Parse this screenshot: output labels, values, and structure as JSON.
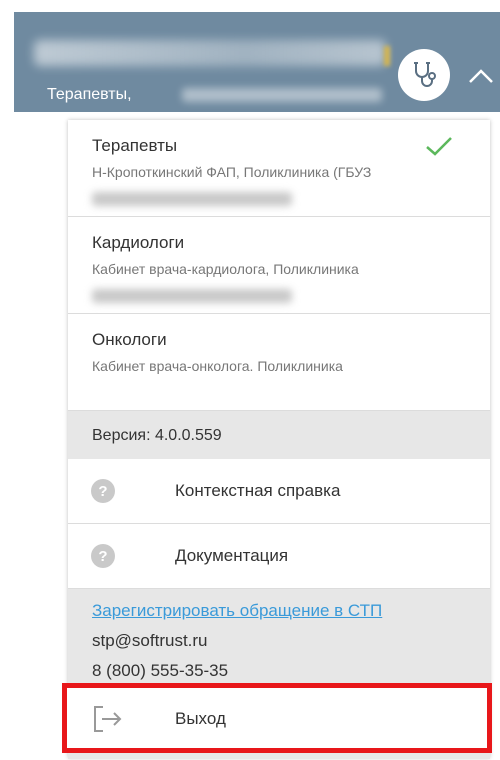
{
  "header": {
    "role_label": "Терапевты,",
    "avatar_icon": "stethoscope-icon",
    "toggle_icon": "chevron-up-icon"
  },
  "menu": {
    "roles": [
      {
        "title": "Терапевты",
        "subtitle": "Н-Кропоткинский ФАП, Поликлиника (ГБУЗ",
        "selected": true
      },
      {
        "title": "Кардиологи",
        "subtitle": "Кабинет врача-кардиолога, Поликлиника",
        "selected": false
      },
      {
        "title": "Онкологи",
        "subtitle": "Кабинет врача-онколога. Поликлиника",
        "selected": false
      }
    ],
    "version_label": "Версия: 4.0.0.559",
    "context_help_label": "Контекстная справка",
    "documentation_label": "Документация",
    "support": {
      "link_text": "Зарегистрировать обращение в СТП",
      "email": "stp@softrust.ru",
      "phone": "8 (800) 555-35-35"
    },
    "logout_label": "Выход"
  },
  "colors": {
    "header_bg": "#6f8aa0",
    "link": "#3a9ad9",
    "check": "#5cb85c",
    "highlight_border": "#e8171a",
    "grey_section": "#e7e7e7"
  }
}
